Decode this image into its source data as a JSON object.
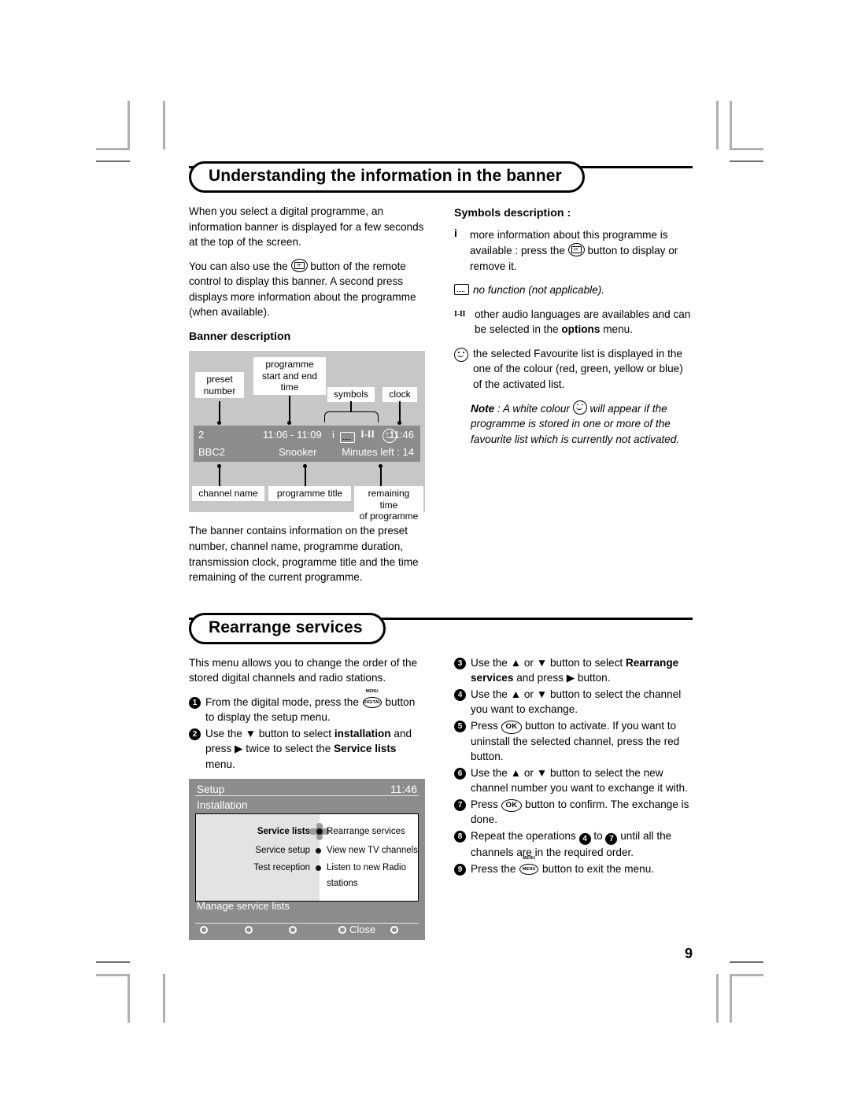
{
  "page": {
    "number": "9"
  },
  "section1": {
    "title": "Understanding the information in the banner",
    "left": {
      "p1": "When you select a digital programme, an information banner is displayed for a few seconds at the top of the screen.",
      "p2a": "You can also use the",
      "p2b": "button of the remote control to display this banner. A second press displays more information about the programme (when available).",
      "subhead": "Banner description",
      "p3": "The banner contains information on the preset number, channel name, programme duration, transmission clock, programme title and the time remaining of the current programme."
    },
    "diagram": {
      "labels": {
        "preset_number": "preset\nnumber",
        "programme_time": "programme\nstart and end\ntime",
        "symbols": "symbols",
        "clock": "clock",
        "channel_name": "channel name",
        "programme_title": "programme title",
        "remaining_time": "remaining time\nof programme"
      },
      "banner": {
        "preset": "2",
        "time_range": "11:06 - 11:09",
        "symbol_i": "i",
        "symbol_audio": "I-II",
        "clock": "11:46",
        "channel": "BBC2",
        "title": "Snooker",
        "remaining": "Minutes left : 14"
      },
      "colors": {
        "diagram_bg": "#c7c7c7",
        "banner_bg": "#8c8c8c",
        "label_bg": "#ffffff"
      }
    },
    "right": {
      "subhead": "Symbols description :",
      "item_i_marker": "i",
      "item_i_a": "more information about this programme is available : press the",
      "item_i_b": "button to display or remove it.",
      "item_sub": "no function (not applicable).",
      "item_audio_marker": "I-II",
      "item_audio_a": "other audio languages are availables and can be selected in the",
      "item_audio_bold": "options",
      "item_audio_b": "menu.",
      "item_fav": "the selected Favourite list is displayed in the one of the colour (red, green, yellow or blue) of the activated list.",
      "note_bold": "Note",
      "note_a": ": A white colour",
      "note_b": "will appear if the programme is stored in one or more of the favourite list which is currently not activated."
    }
  },
  "section2": {
    "title": "Rearrange services",
    "left": {
      "p1": "This menu allows you to change the order of the stored digital channels and radio stations.",
      "steps": [
        {
          "num": "1",
          "a": "From the digital mode, press the",
          "b": "button to display the setup menu."
        },
        {
          "num": "2",
          "a": "Use the ▼ button to select",
          "bold1": "installation",
          "b": "and press ▶ twice to select the",
          "bold2": "Service lists",
          "c": "menu."
        }
      ]
    },
    "tvmenu": {
      "title": "Setup",
      "clock": "11:46",
      "subtitle": "Installation",
      "rows": [
        {
          "left": "Service lists",
          "right": "Rearrange services",
          "selected": true
        },
        {
          "left": "Service setup",
          "right": "View new TV channels",
          "selected": false
        },
        {
          "left": "Test reception",
          "right": "Listen to new Radio stations",
          "selected": false
        }
      ],
      "footer_label": "Manage service lists",
      "close_label": "Close",
      "footer_dot_count": 5
    },
    "right": {
      "steps": [
        {
          "num": "3",
          "a": "Use the ▲ or ▼ button to select",
          "bold": "Rearrange services",
          "b": "and press ▶ button."
        },
        {
          "num": "4",
          "a": "Use the ▲ or ▼ button to select the channel you want to exchange."
        },
        {
          "num": "5",
          "a": "Press",
          "b": "button to activate. If you want to uninstall the selected channel, press the red button."
        },
        {
          "num": "6",
          "a": "Use the ▲ or ▼ button to select the new channel number you want to exchange it with."
        },
        {
          "num": "7",
          "a": "Press",
          "b": "button to confirm. The exchange is done."
        },
        {
          "num": "8",
          "a": "Repeat the operations",
          "ref1": "4",
          "b": "to",
          "ref2": "7",
          "c": "until all the channels are in the required order."
        },
        {
          "num": "9",
          "a": "Press the",
          "b": "button to exit the menu."
        }
      ]
    }
  },
  "icons": {
    "info_button": "info-plus-button-icon",
    "subtitle_box": "subtitle-box-icon",
    "audio_languages": "audio-languages-icon",
    "smiley": "smiley-favourite-icon",
    "menu_digital_button": "menu-digital-button-icon",
    "menu_button": "menu-button-icon",
    "ok_button": "ok-button-icon",
    "ok_label": "OK",
    "digital_label": "DIGITAL",
    "menu_label": "MENU"
  }
}
